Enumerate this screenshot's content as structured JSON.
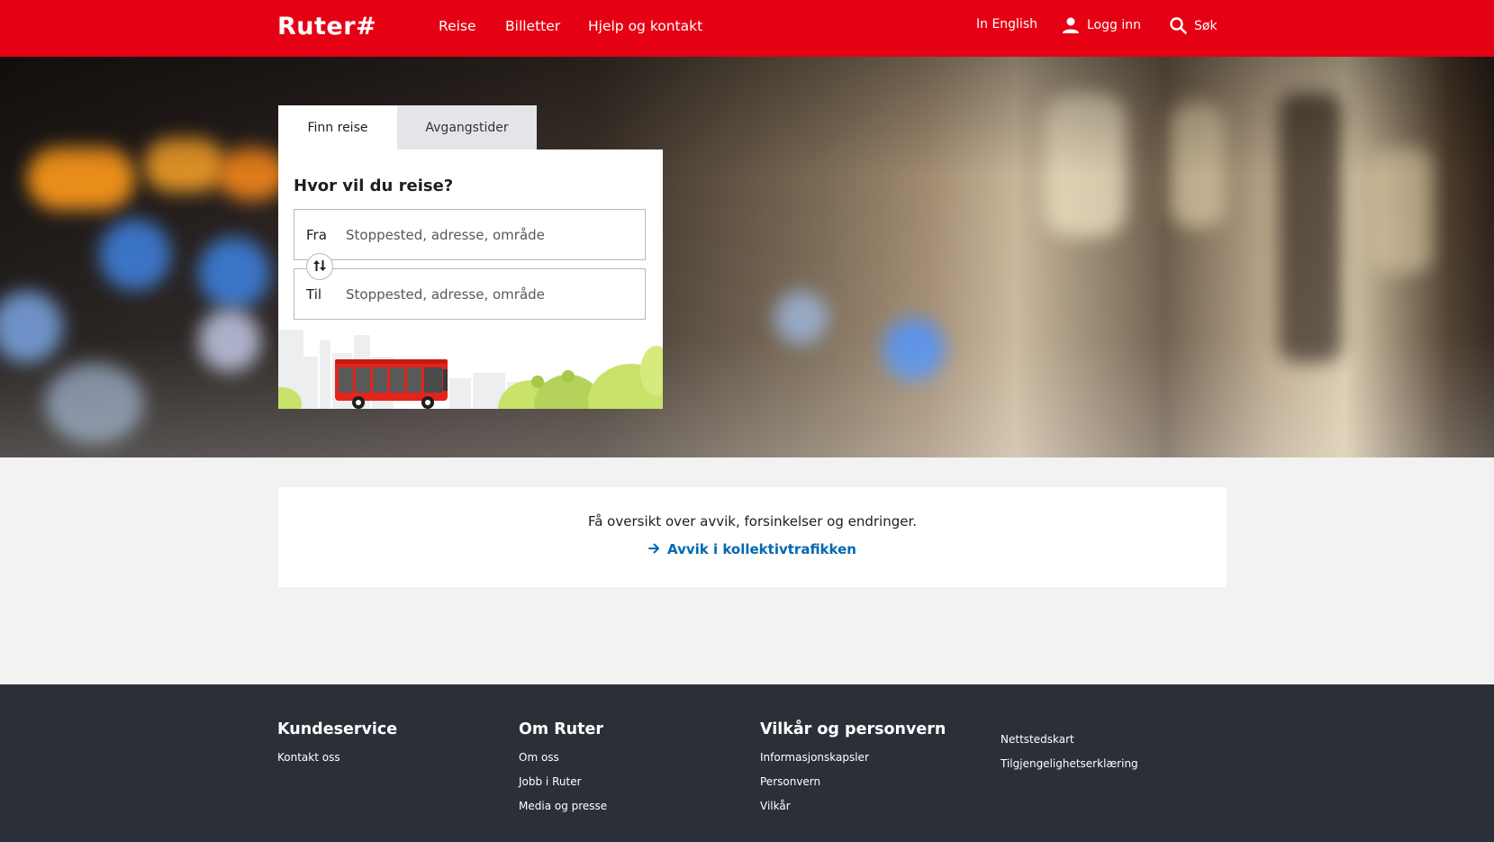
{
  "header": {
    "logo": "Ruter#",
    "nav": [
      "Reise",
      "Billetter",
      "Hjelp og kontakt"
    ],
    "language": "In English",
    "login": "Logg inn",
    "search": "Søk"
  },
  "search_card": {
    "tabs": [
      "Finn reise",
      "Avgangstider"
    ],
    "active_tab": "Finn reise",
    "title": "Hvor vil du reise?",
    "from_label": "Fra",
    "from_placeholder": "Stoppested, adresse, område",
    "from_value": "",
    "to_label": "Til",
    "to_placeholder": "Stoppested, adresse, område",
    "to_value": ""
  },
  "notice": {
    "text": "Få oversikt over avvik, forsinkelser og endringer.",
    "link": "Avvik i kollektivtrafikken"
  },
  "footer": {
    "columns": [
      {
        "heading": "Kundeservice",
        "links": [
          "Kontakt oss"
        ]
      },
      {
        "heading": "Om Ruter",
        "links": [
          "Om oss",
          "Jobb i Ruter",
          "Media og presse"
        ]
      },
      {
        "heading": "Vilkår og personvern",
        "links": [
          "Informasjonskapsler",
          "Personvern",
          "Vilkår"
        ]
      },
      {
        "heading": "",
        "links": [
          "Nettstedskart",
          "Tilgjengelighetserklæring"
        ]
      }
    ]
  },
  "colors": {
    "brand_red": "#e60014",
    "link_blue": "#0068b3",
    "footer_bg": "#2b3038",
    "page_bg": "#f2f2f2",
    "bus_red": "#e3241b"
  }
}
